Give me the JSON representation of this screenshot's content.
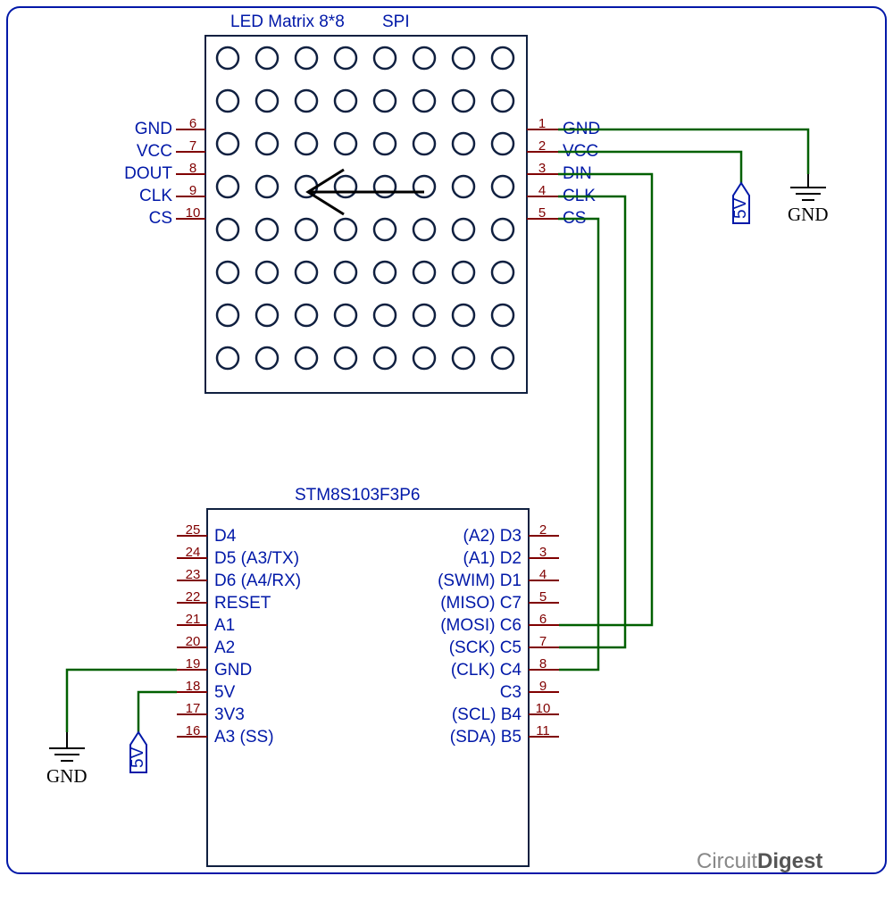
{
  "title": {
    "module": "LED Matrix 8*8",
    "bus": "SPI"
  },
  "mcu": {
    "name": "STM8S103F3P6"
  },
  "matrix_left_pins": [
    {
      "num": "6",
      "label": "GND"
    },
    {
      "num": "7",
      "label": "VCC"
    },
    {
      "num": "8",
      "label": "DOUT"
    },
    {
      "num": "9",
      "label": "CLK"
    },
    {
      "num": "10",
      "label": "CS"
    }
  ],
  "matrix_right_pins": [
    {
      "num": "1",
      "label": "GND"
    },
    {
      "num": "2",
      "label": "VCC"
    },
    {
      "num": "3",
      "label": "DIN"
    },
    {
      "num": "4",
      "label": "CLK"
    },
    {
      "num": "5",
      "label": "CS"
    }
  ],
  "mcu_left_pins": [
    {
      "num": "25",
      "label": "D4"
    },
    {
      "num": "24",
      "label": "D5 (A3/TX)"
    },
    {
      "num": "23",
      "label": "D6 (A4/RX)"
    },
    {
      "num": "22",
      "label": "RESET"
    },
    {
      "num": "21",
      "label": "A1"
    },
    {
      "num": "20",
      "label": "A2"
    },
    {
      "num": "19",
      "label": "GND"
    },
    {
      "num": "18",
      "label": "5V"
    },
    {
      "num": "17",
      "label": "3V3"
    },
    {
      "num": "16",
      "label": "A3 (SS)"
    }
  ],
  "mcu_right_pins": [
    {
      "num": "2",
      "label": "(A2) D3"
    },
    {
      "num": "3",
      "label": "(A1) D2"
    },
    {
      "num": "4",
      "label": "(SWIM) D1"
    },
    {
      "num": "5",
      "label": "(MISO) C7"
    },
    {
      "num": "6",
      "label": "(MOSI) C6"
    },
    {
      "num": "7",
      "label": "(SCK) C5"
    },
    {
      "num": "8",
      "label": "(CLK) C4"
    },
    {
      "num": "9",
      "label": "C3"
    },
    {
      "num": "10",
      "label": "(SCL) B4"
    },
    {
      "num": "11",
      "label": "(SDA) B5"
    }
  ],
  "power_labels": {
    "five_v": "5V",
    "gnd": "GND"
  },
  "watermark": {
    "a": "Circuit",
    "b": "Digest"
  },
  "connections_description": "DIN→MOSI C6, CLK→SCK C5, CS→CLK C4, matrix GND→GND symbol, matrix VCC→5V tag; MCU GND(pin19)→GND symbol, MCU 5V(pin18)→5V tag"
}
